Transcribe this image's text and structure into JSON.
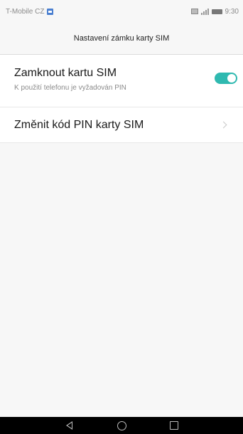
{
  "status_bar": {
    "carrier": "T-Mobile CZ",
    "time": "9:30",
    "icons": [
      "image-notification-icon",
      "screenshot-icon",
      "signal-icon",
      "battery-icon"
    ]
  },
  "header": {
    "title": "Nastavení zámku karty SIM"
  },
  "settings": {
    "sim_lock": {
      "title": "Zamknout kartu SIM",
      "subtitle": "K použití telefonu je vyžadován PIN",
      "enabled": true,
      "toggle_color": "#2fb9b0"
    },
    "change_pin": {
      "title": "Změnit kód PIN karty SIM"
    }
  },
  "nav_bar": {
    "icons": [
      "back-icon",
      "home-icon",
      "recents-icon"
    ]
  }
}
